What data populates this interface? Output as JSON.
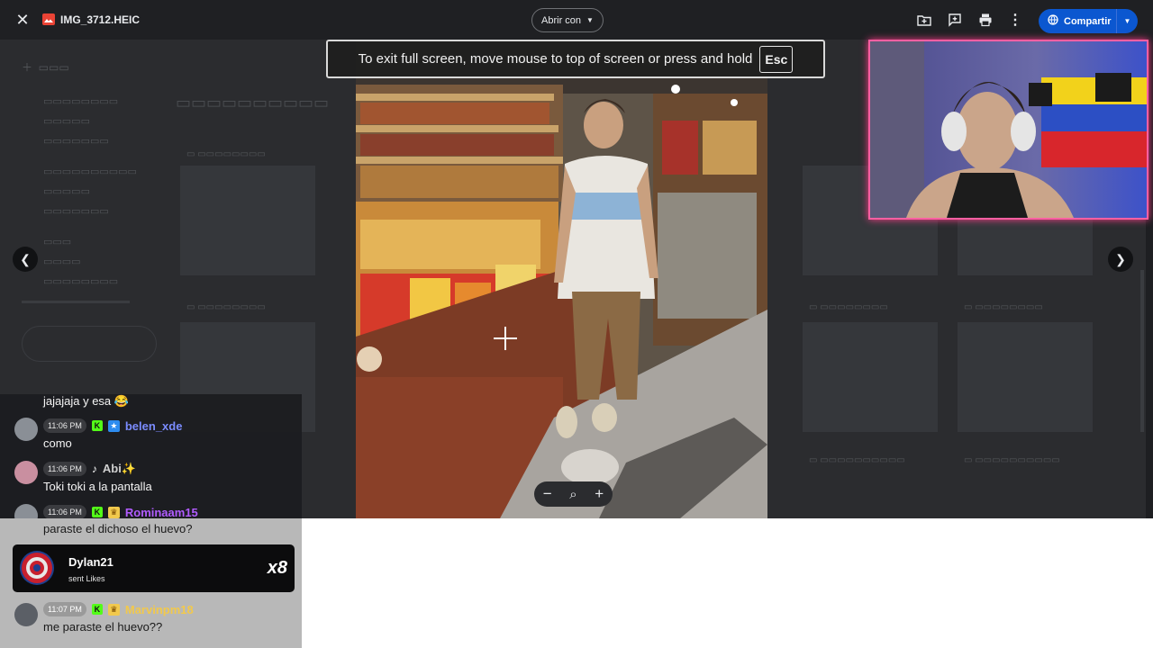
{
  "viewer": {
    "filename": "IMG_3712.HEIC",
    "open_with_label": "Abrir con",
    "share_label": "Compartir",
    "fullscreen_notice": "To exit full screen, move mouse to top of screen or press and hold",
    "esc_key": "Esc",
    "zoom_out": "−",
    "zoom_icon": "⌕",
    "zoom_in": "+"
  },
  "chat": {
    "partial_top": "jajajaja y esa 😂",
    "messages": [
      {
        "time": "11:06 PM",
        "user": "belen_xde",
        "user_color": "#7b8cff",
        "text": "como"
      },
      {
        "time": "11:06 PM",
        "user": "Abi✨",
        "user_color": "#cfcfcf",
        "text": "Toki toki a la pantalla"
      },
      {
        "time": "11:06 PM",
        "user": "Rominaam15",
        "user_color": "#b15cff",
        "text": "paraste el dichoso el huevo?"
      },
      {
        "time": "11:07 PM",
        "user": "Marvinpm18",
        "user_color": "#f2c94c",
        "text": "me paraste el huevo??"
      }
    ],
    "gift": {
      "user": "Dylan21",
      "action": "sent Likes",
      "multiplier": "x8"
    }
  },
  "colors": {
    "accent": "#0b57d0",
    "webcam_border": "#ff5fa2",
    "kick_green": "#53fc18"
  }
}
